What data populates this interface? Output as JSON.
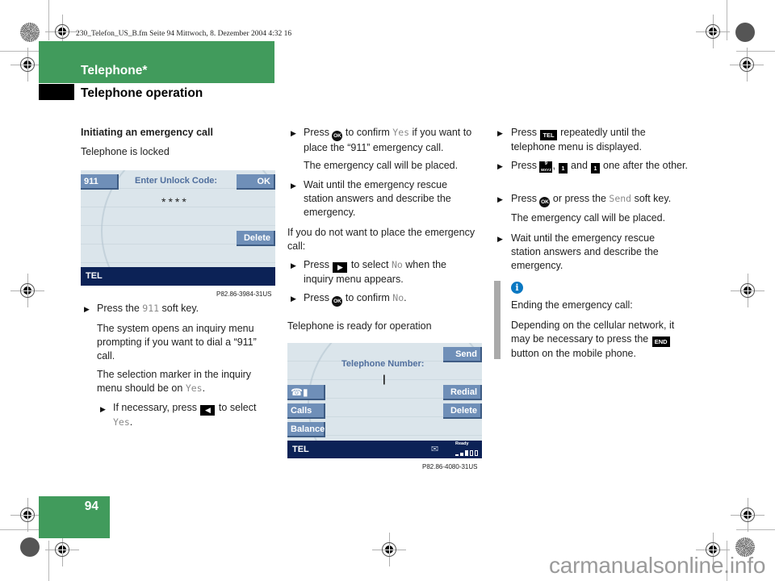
{
  "print_meta": "230_Telefon_US_B.fm  Seite 94  Mittwoch, 8. Dezember 2004  4:32 16",
  "header": {
    "chapter": "Telephone*",
    "section": "Telephone operation"
  },
  "page_number": "94",
  "watermark": "carmanualsonline.info",
  "colors": {
    "brand_green": "#419b5c",
    "screen_navy": "#0c2256",
    "softkey_blue": "#6f8fb8",
    "info_blue": "#0a78c2"
  },
  "col1": {
    "heading": "Initiating an emergency call",
    "subheading": "Telephone is locked",
    "screen1": {
      "softkey_left": "911",
      "prompt": "Enter Unlock Code:",
      "softkey_ok": "OK",
      "code_mask": "****",
      "softkey_delete": "Delete",
      "status_label": "TEL",
      "figure_id": "P82.86-3984-31US"
    },
    "step1": {
      "pre": "Press the ",
      "code": "911",
      "post": " soft key."
    },
    "para1": "The system opens an inquiry menu prompting if you want to dial a “911” call.",
    "para2_pre": "The selection marker in the inquiry menu should be on ",
    "para2_code": "Yes",
    "para2_post": ".",
    "substep": {
      "pre": "If necessary, press ",
      "key": "◀",
      "post": " to select",
      "code": "Yes",
      "end": "."
    }
  },
  "col2": {
    "step1": {
      "pre": "Press ",
      "key": "OK",
      "mid": " to confirm ",
      "code": "Yes",
      "post": " if you want to place the “911” emergency call."
    },
    "para1": "The emergency call will be placed.",
    "step2": "Wait until the emergency rescue station answers and describe the emergency.",
    "para2": "If you do not want to place the emergency call:",
    "step3": {
      "pre": "Press ",
      "key": "▶",
      "mid": " to select ",
      "code": "No",
      "post": " when the inquiry menu appears."
    },
    "step4": {
      "pre": "Press ",
      "key": "OK",
      "mid": " to confirm ",
      "code": "No",
      "post": "."
    },
    "subheading": "Telephone is ready for operation",
    "screen2": {
      "prompt": "Telephone Number:",
      "cursor": "|",
      "softkey_send": "Send",
      "softkey_phonebook_icon": "phonebook-icon",
      "softkey_redial": "Redial",
      "softkey_calls": "Calls",
      "softkey_delete": "Delete",
      "softkey_balance": "Balance",
      "status_label": "TEL",
      "status_ready": "Ready",
      "signal_strength_bars": "3 of 5",
      "message_icon": "envelope-icon",
      "figure_id": "P82.86-4080-31US"
    }
  },
  "col3": {
    "step1": {
      "pre": "Press ",
      "key": "TEL",
      "post": " repeatedly until the telephone menu is displayed."
    },
    "step2": {
      "pre": "Press ",
      "key1_top": "9",
      "key1_bottom": "WXYZ",
      "key2": "1",
      "and": " and ",
      "key3": "1",
      "post": " one after the other."
    },
    "step3": {
      "pre": "Press ",
      "key": "OK",
      "mid": " or press the ",
      "code": "Send",
      "post": " soft key."
    },
    "para1": "The emergency call will be placed.",
    "step4": "Wait until the emergency rescue station answers and describe the emergency.",
    "info": {
      "title": "Ending the emergency call:",
      "body_pre": "Depending on the cellular network, it may be necessary to press the ",
      "key": "END",
      "body_post": " button on the mobile phone."
    }
  }
}
